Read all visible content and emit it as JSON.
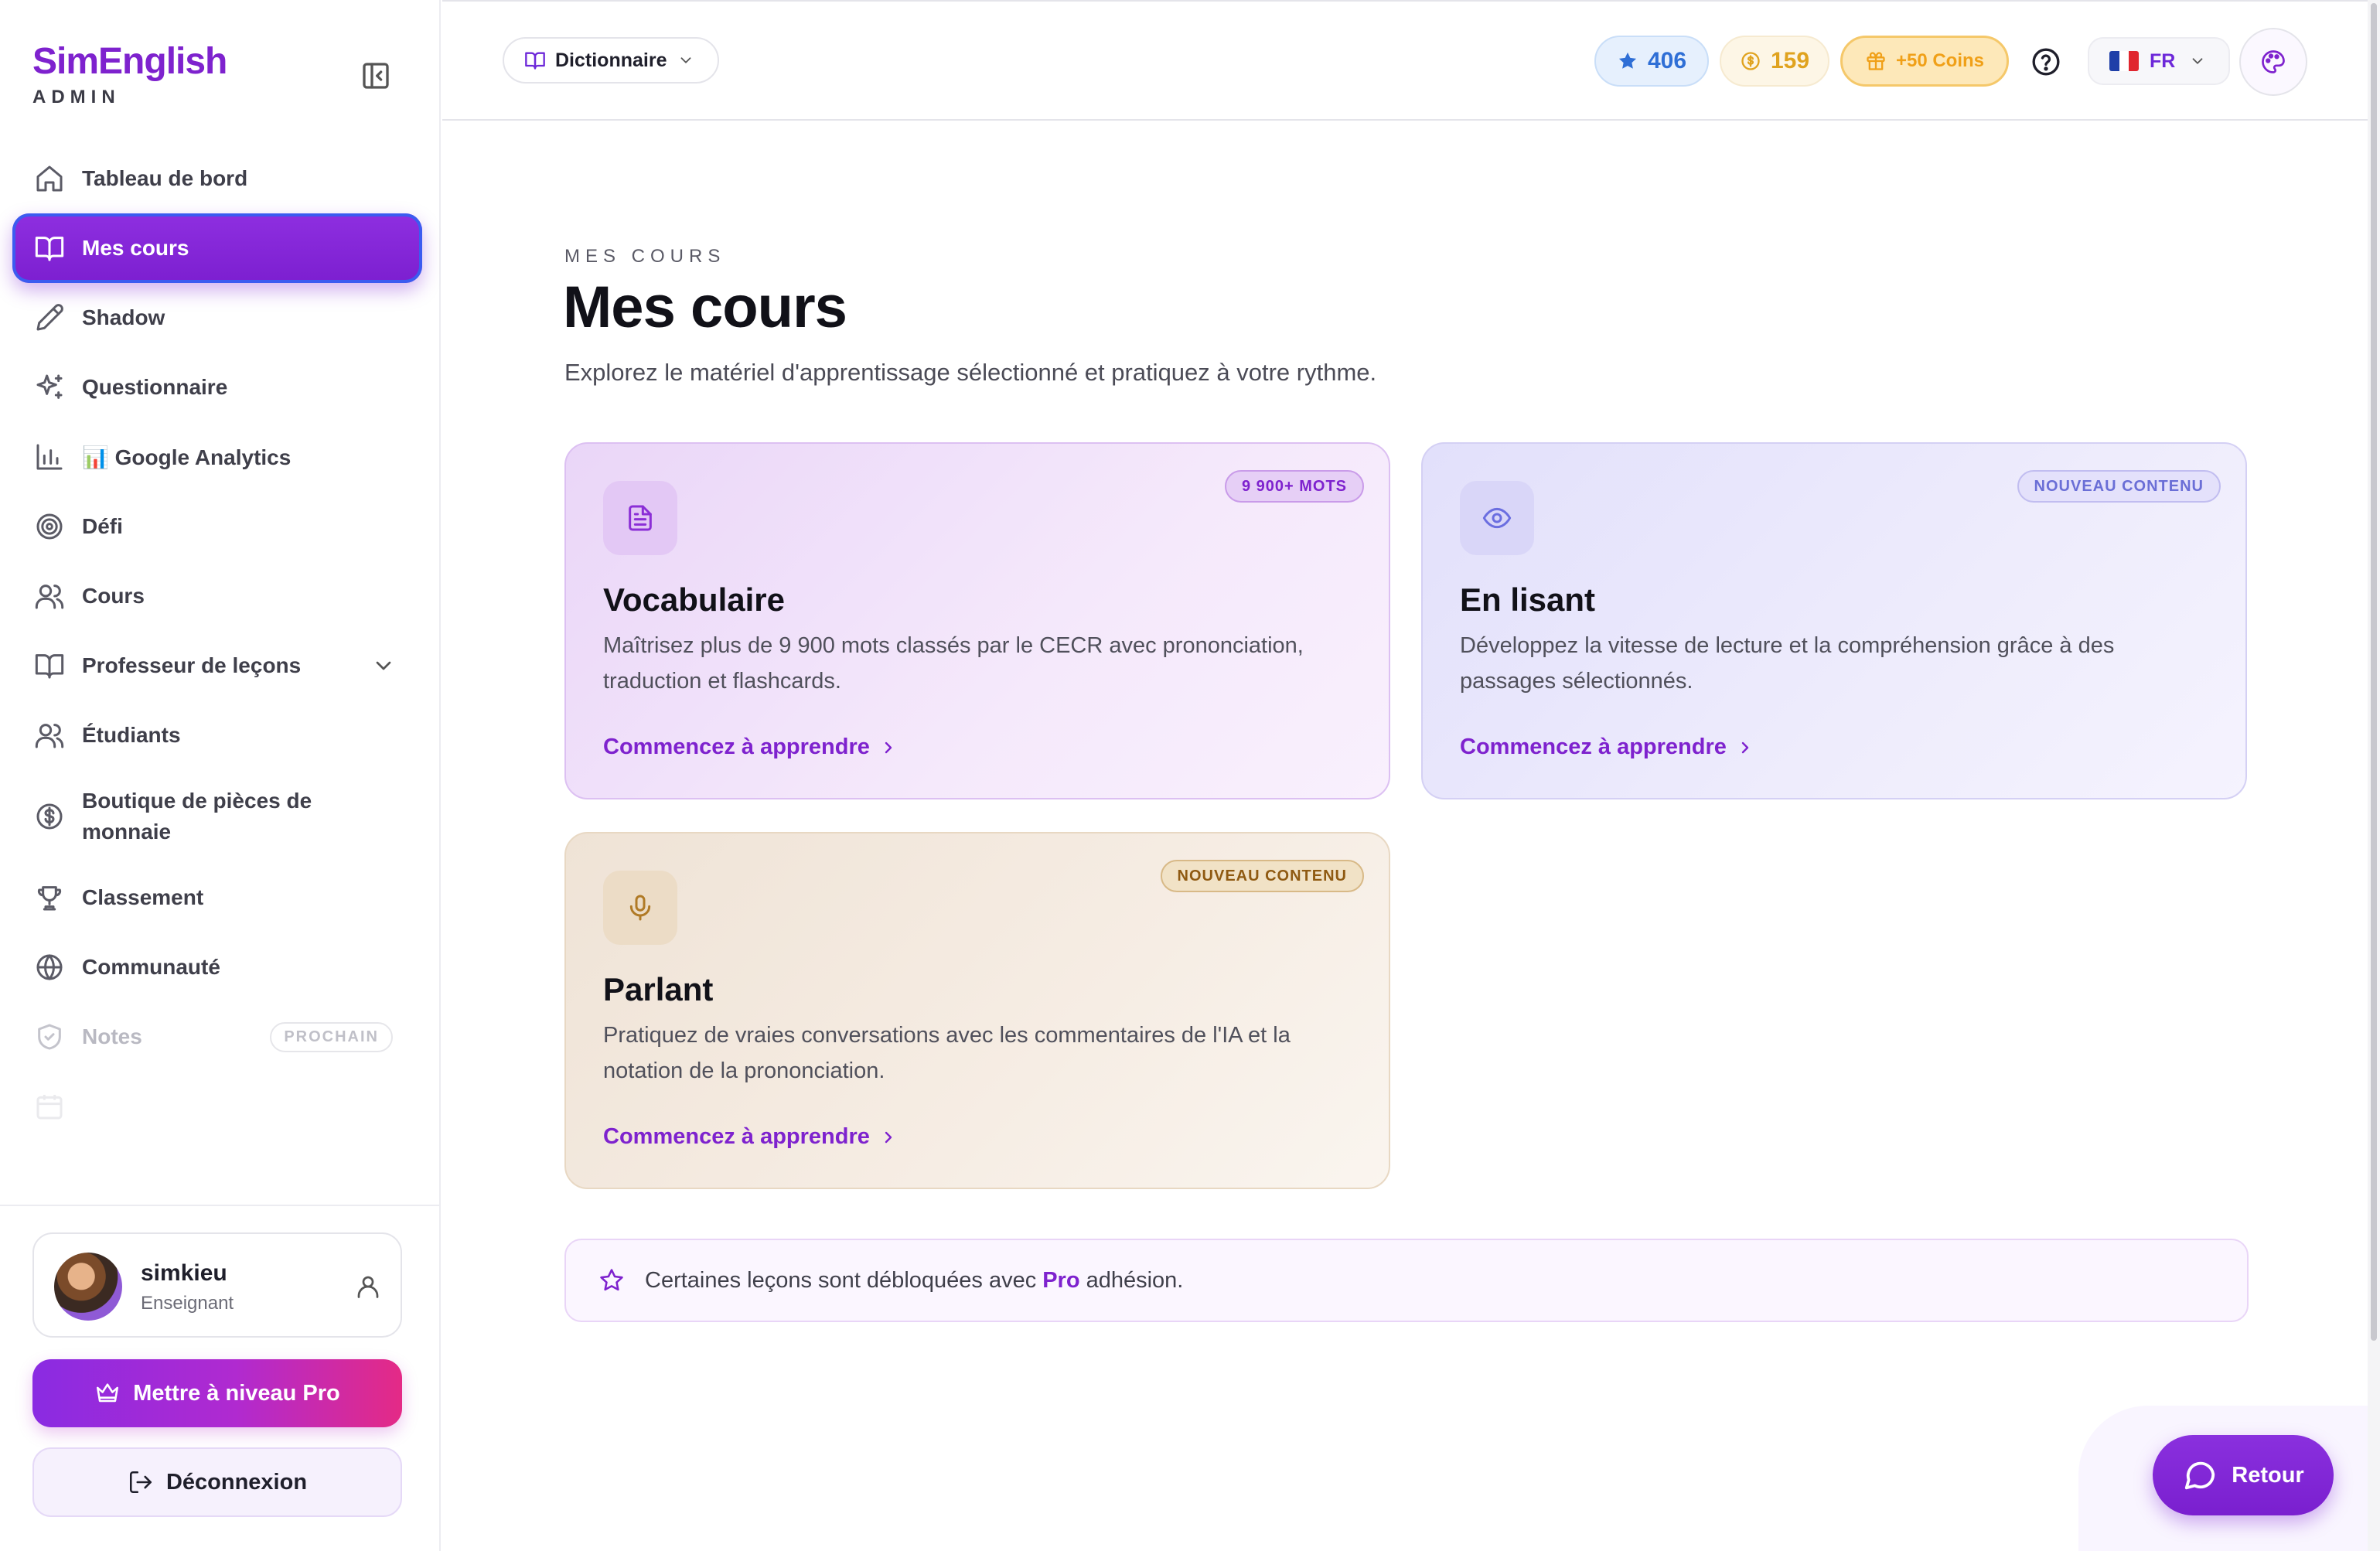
{
  "brand": {
    "name": "SimEnglish",
    "subtitle": "ADMIN"
  },
  "sidebar": {
    "items": [
      {
        "label": "Tableau de bord",
        "icon": "home-icon"
      },
      {
        "label": "Mes cours",
        "icon": "book-open-icon",
        "active": true
      },
      {
        "label": "Shadow",
        "icon": "pen-icon"
      },
      {
        "label": "Questionnaire",
        "icon": "sparkles-icon"
      },
      {
        "label": "📊 Google Analytics",
        "icon": "bar-chart-icon"
      },
      {
        "label": "Défi",
        "icon": "target-icon"
      },
      {
        "label": "Cours",
        "icon": "users-icon"
      },
      {
        "label": "Professeur de leçons",
        "icon": "book-open-icon"
      },
      {
        "label": "Étudiants",
        "icon": "users-icon"
      },
      {
        "label": "Boutique de pièces de monnaie",
        "icon": "dollar-circle-icon"
      },
      {
        "label": "Classement",
        "icon": "trophy-icon"
      },
      {
        "label": "Communauté",
        "icon": "globe-icon"
      },
      {
        "label": "Notes",
        "icon": "shield-icon",
        "badge": "PROCHAIN"
      }
    ],
    "user": {
      "name": "simkieu",
      "role": "Enseignant"
    },
    "upgrade_label": "Mettre à niveau Pro",
    "logout_label": "Déconnexion"
  },
  "topbar": {
    "dictionary_label": "Dictionnaire",
    "stars": "406",
    "coins": "159",
    "bonus": "+50 Coins",
    "language": "FR"
  },
  "main": {
    "eyebrow": "MES COURS",
    "title": "Mes cours",
    "subtitle": "Explorez le matériel d'apprentissage sélectionné et pratiquez à votre rythme.",
    "cards": [
      {
        "title": "Vocabulaire",
        "badge": "9 900+ MOTS",
        "description": "Maîtrisez plus de 9 900 mots classés par le CECR avec prononciation, traduction et flashcards.",
        "link": "Commencez à apprendre",
        "icon": "document-icon"
      },
      {
        "title": "En lisant",
        "badge": "NOUVEAU CONTENU",
        "description": "Développez la vitesse de lecture et la compréhension grâce à des passages sélectionnés.",
        "link": "Commencez à apprendre",
        "icon": "eye-icon"
      },
      {
        "title": "Parlant",
        "badge": "NOUVEAU CONTENU",
        "description": "Pratiquez de vraies conversations avec les commentaires de l'IA et la notation de la prononciation.",
        "link": "Commencez à apprendre",
        "icon": "microphone-icon"
      }
    ],
    "pro_note": {
      "before": "Certaines leçons sont débloquées avec",
      "highlight": "Pro",
      "after": "adhésion."
    }
  },
  "feedback_label": "Retour",
  "colors": {
    "accent": "#7e22ce",
    "active_nav": "#8a2be2",
    "upgrade_gradient_end": "#e42a86"
  }
}
